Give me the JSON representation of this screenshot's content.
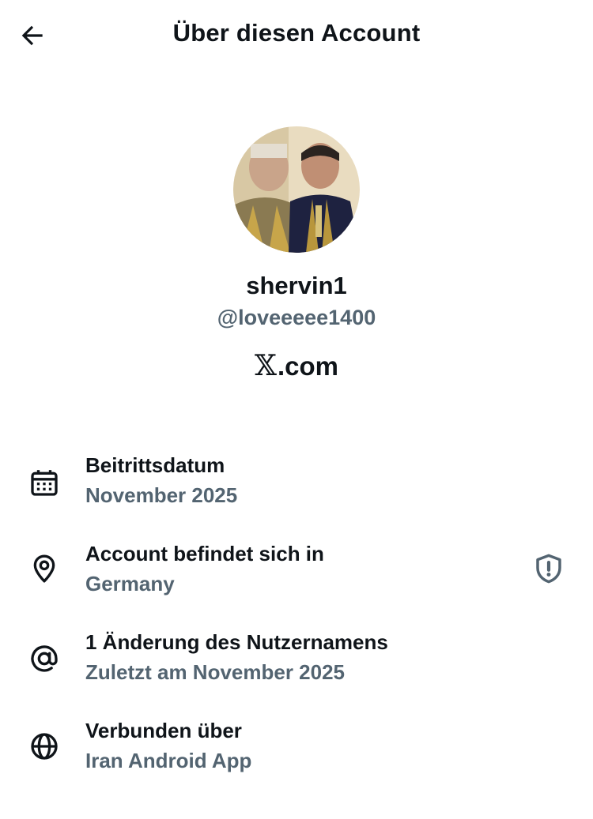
{
  "header": {
    "title": "Über diesen Account",
    "back_icon": "arrow-left-icon"
  },
  "profile": {
    "display_name": "shervin1",
    "handle": "@loveeeee1400",
    "site_logo": "𝕏",
    "site_text": ".com"
  },
  "info": [
    {
      "icon": "calendar-icon",
      "title": "Beitrittsdatum",
      "value": "November 2025"
    },
    {
      "icon": "location-pin-icon",
      "title": "Account befindet sich in",
      "value": "Germany",
      "action_icon": "shield-alert-icon"
    },
    {
      "icon": "at-sign-icon",
      "title": "1 Änderung des Nutzernamens",
      "value": "Zuletzt am November 2025"
    },
    {
      "icon": "globe-icon",
      "title": "Verbunden über",
      "value": "Iran Android App"
    }
  ],
  "colors": {
    "text_primary": "#0f1419",
    "text_secondary": "#536471",
    "background": "#ffffff"
  }
}
